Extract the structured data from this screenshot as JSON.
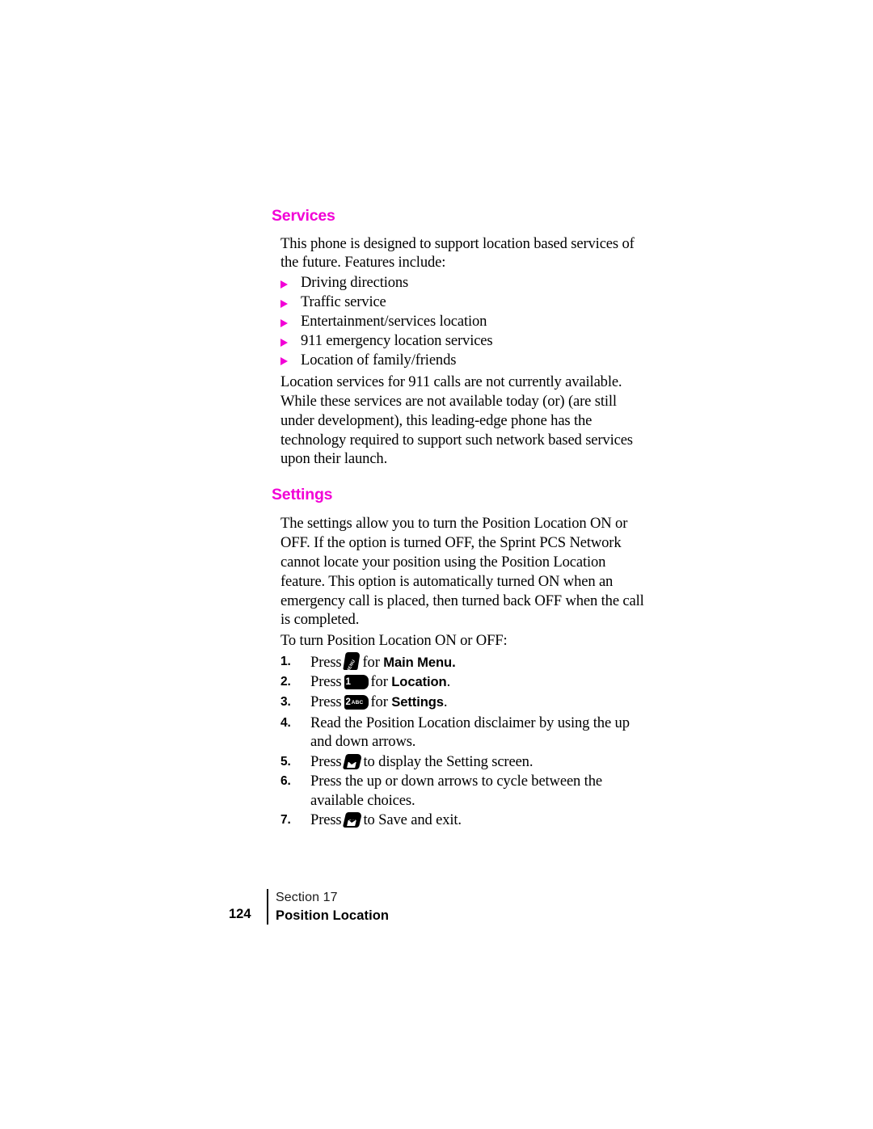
{
  "page": {
    "background_color": "#ffffff",
    "accent_color": "#f200d6",
    "text_color": "#000000"
  },
  "sections": {
    "services": {
      "heading": "Services",
      "intro": "This phone is designed to support location based services of the future. Features include:",
      "bullets": [
        "Driving directions",
        "Traffic service",
        "Entertainment/services location",
        "911 emergency location services",
        "Location of family/friends"
      ],
      "closing": "Location services for 911 calls are not currently available. While these services are not available today (or) (are still under development), this leading-edge phone has the technology required to support such network based services upon their launch."
    },
    "settings": {
      "heading": "Settings",
      "intro": "The settings allow you to turn the Position Location ON or OFF. If the option is turned OFF, the Sprint PCS Network cannot locate your position using the Position Location feature. This option is automatically turned ON when an emergency call is placed, then turned back OFF when the call is completed.",
      "lead_in": "To turn Position Location ON or OFF:",
      "steps": [
        {
          "number": "1.",
          "prefix": "Press",
          "key": "menu-key",
          "key_label": "MENU",
          "middle": "for",
          "emphasis": "Main Menu.",
          "suffix": ""
        },
        {
          "number": "2.",
          "prefix": "Press",
          "key": "number-key-1",
          "key_label": "1",
          "key_sublabel": "",
          "middle": "for",
          "emphasis": "Location",
          "suffix": "."
        },
        {
          "number": "3.",
          "prefix": "Press",
          "key": "number-key-2",
          "key_label": "2",
          "key_sublabel": "ABC",
          "middle": "for",
          "emphasis": "Settings",
          "suffix": "."
        },
        {
          "number": "4.",
          "prefix": "Read the Position Location disclaimer by using the up and down arrows.",
          "key": "",
          "key_label": "",
          "middle": "",
          "emphasis": "",
          "suffix": ""
        },
        {
          "number": "5.",
          "prefix": "Press",
          "key": "ok-key",
          "key_label": "OK",
          "middle": "to display the Setting screen.",
          "emphasis": "",
          "suffix": ""
        },
        {
          "number": "6.",
          "prefix": "Press the up or down arrows to cycle between the available choices.",
          "key": "",
          "key_label": "",
          "middle": "",
          "emphasis": "",
          "suffix": ""
        },
        {
          "number": "7.",
          "prefix": "Press",
          "key": "ok-key",
          "key_label": "OK",
          "middle": "to Save and exit.",
          "emphasis": "",
          "suffix": ""
        }
      ]
    }
  },
  "footer": {
    "page_number": "124",
    "section_label": "Section 17",
    "chapter_title": "Position Location"
  }
}
